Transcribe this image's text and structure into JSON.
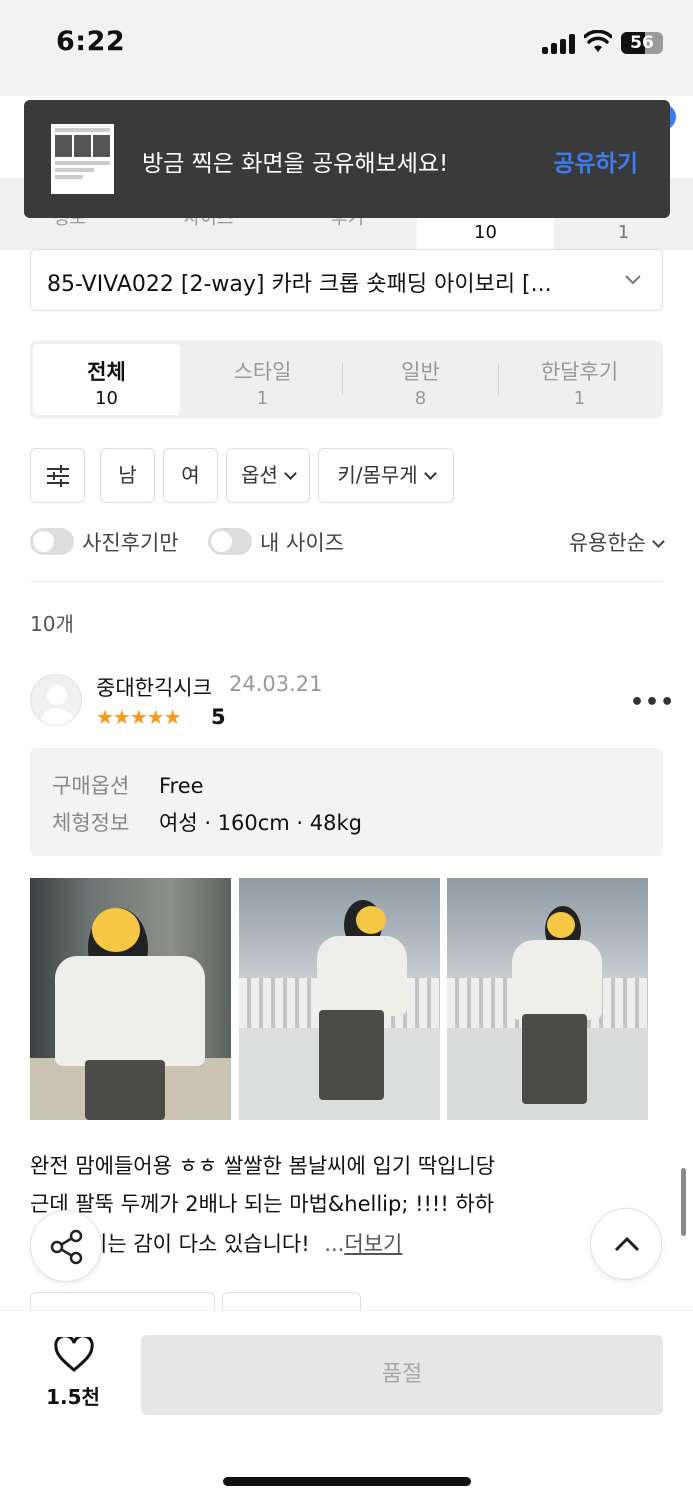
{
  "status_bar": {
    "time": "6:22",
    "battery": "56",
    "battery_level": 0.56
  },
  "toast": {
    "message": "방금 찍은 화면을 공유해보세요!",
    "action": "공유하기"
  },
  "top_tabs": [
    {
      "label": "정보",
      "count": ""
    },
    {
      "label": "사이즈",
      "count": ""
    },
    {
      "label": "후기",
      "count": "10"
    },
    {
      "label": "문의",
      "count": "1"
    }
  ],
  "option_select": {
    "value": "85-VIVA022 [2-way] 카라 크롭 숏패딩 아이보리 [..."
  },
  "segment_tabs": [
    {
      "label": "전체",
      "count": "10"
    },
    {
      "label": "스타일",
      "count": "1"
    },
    {
      "label": "일반",
      "count": "8"
    },
    {
      "label": "한달후기",
      "count": "1"
    }
  ],
  "filters": {
    "male": "남",
    "female": "여",
    "option": "옵션",
    "height_weight": "키/몸무게"
  },
  "toggles": {
    "photo_only": "사진후기만",
    "my_size": "내 사이즈"
  },
  "sort": {
    "label": "유용한순"
  },
  "review_count": "10개",
  "review": {
    "user": "중대한긱시크",
    "date": "24.03.21",
    "stars": "★★★★★",
    "rating": "5",
    "option_key": "구매옵션",
    "option_value": "Free",
    "body_key": "체형정보",
    "body_value": "여성 · 160cm · 48kg",
    "text_line1": "완전 맘에들어용 ㅎㅎ 쌀쌀한 봄날씨에 입기 딱입니당",
    "text_line2": "근데 팔뚝 두께가 2배나 되는 마법&hellip; !!!! 하하",
    "text_line3": "이는 감이 다소 있습니다!",
    "more_prefix": "...",
    "more": "더보기"
  },
  "bottom_bar": {
    "like_count": "1.5천",
    "buy_label": "품절"
  },
  "icons": {
    "filter": "sliders-icon",
    "share": "share-icon",
    "scroll_top": "chevron-up-icon",
    "like": "heart-icon",
    "more": "more-icon"
  },
  "colors": {
    "accent": "#3d7cf0",
    "star": "#f59b1c",
    "toast_bg": "#3a3a3a"
  }
}
